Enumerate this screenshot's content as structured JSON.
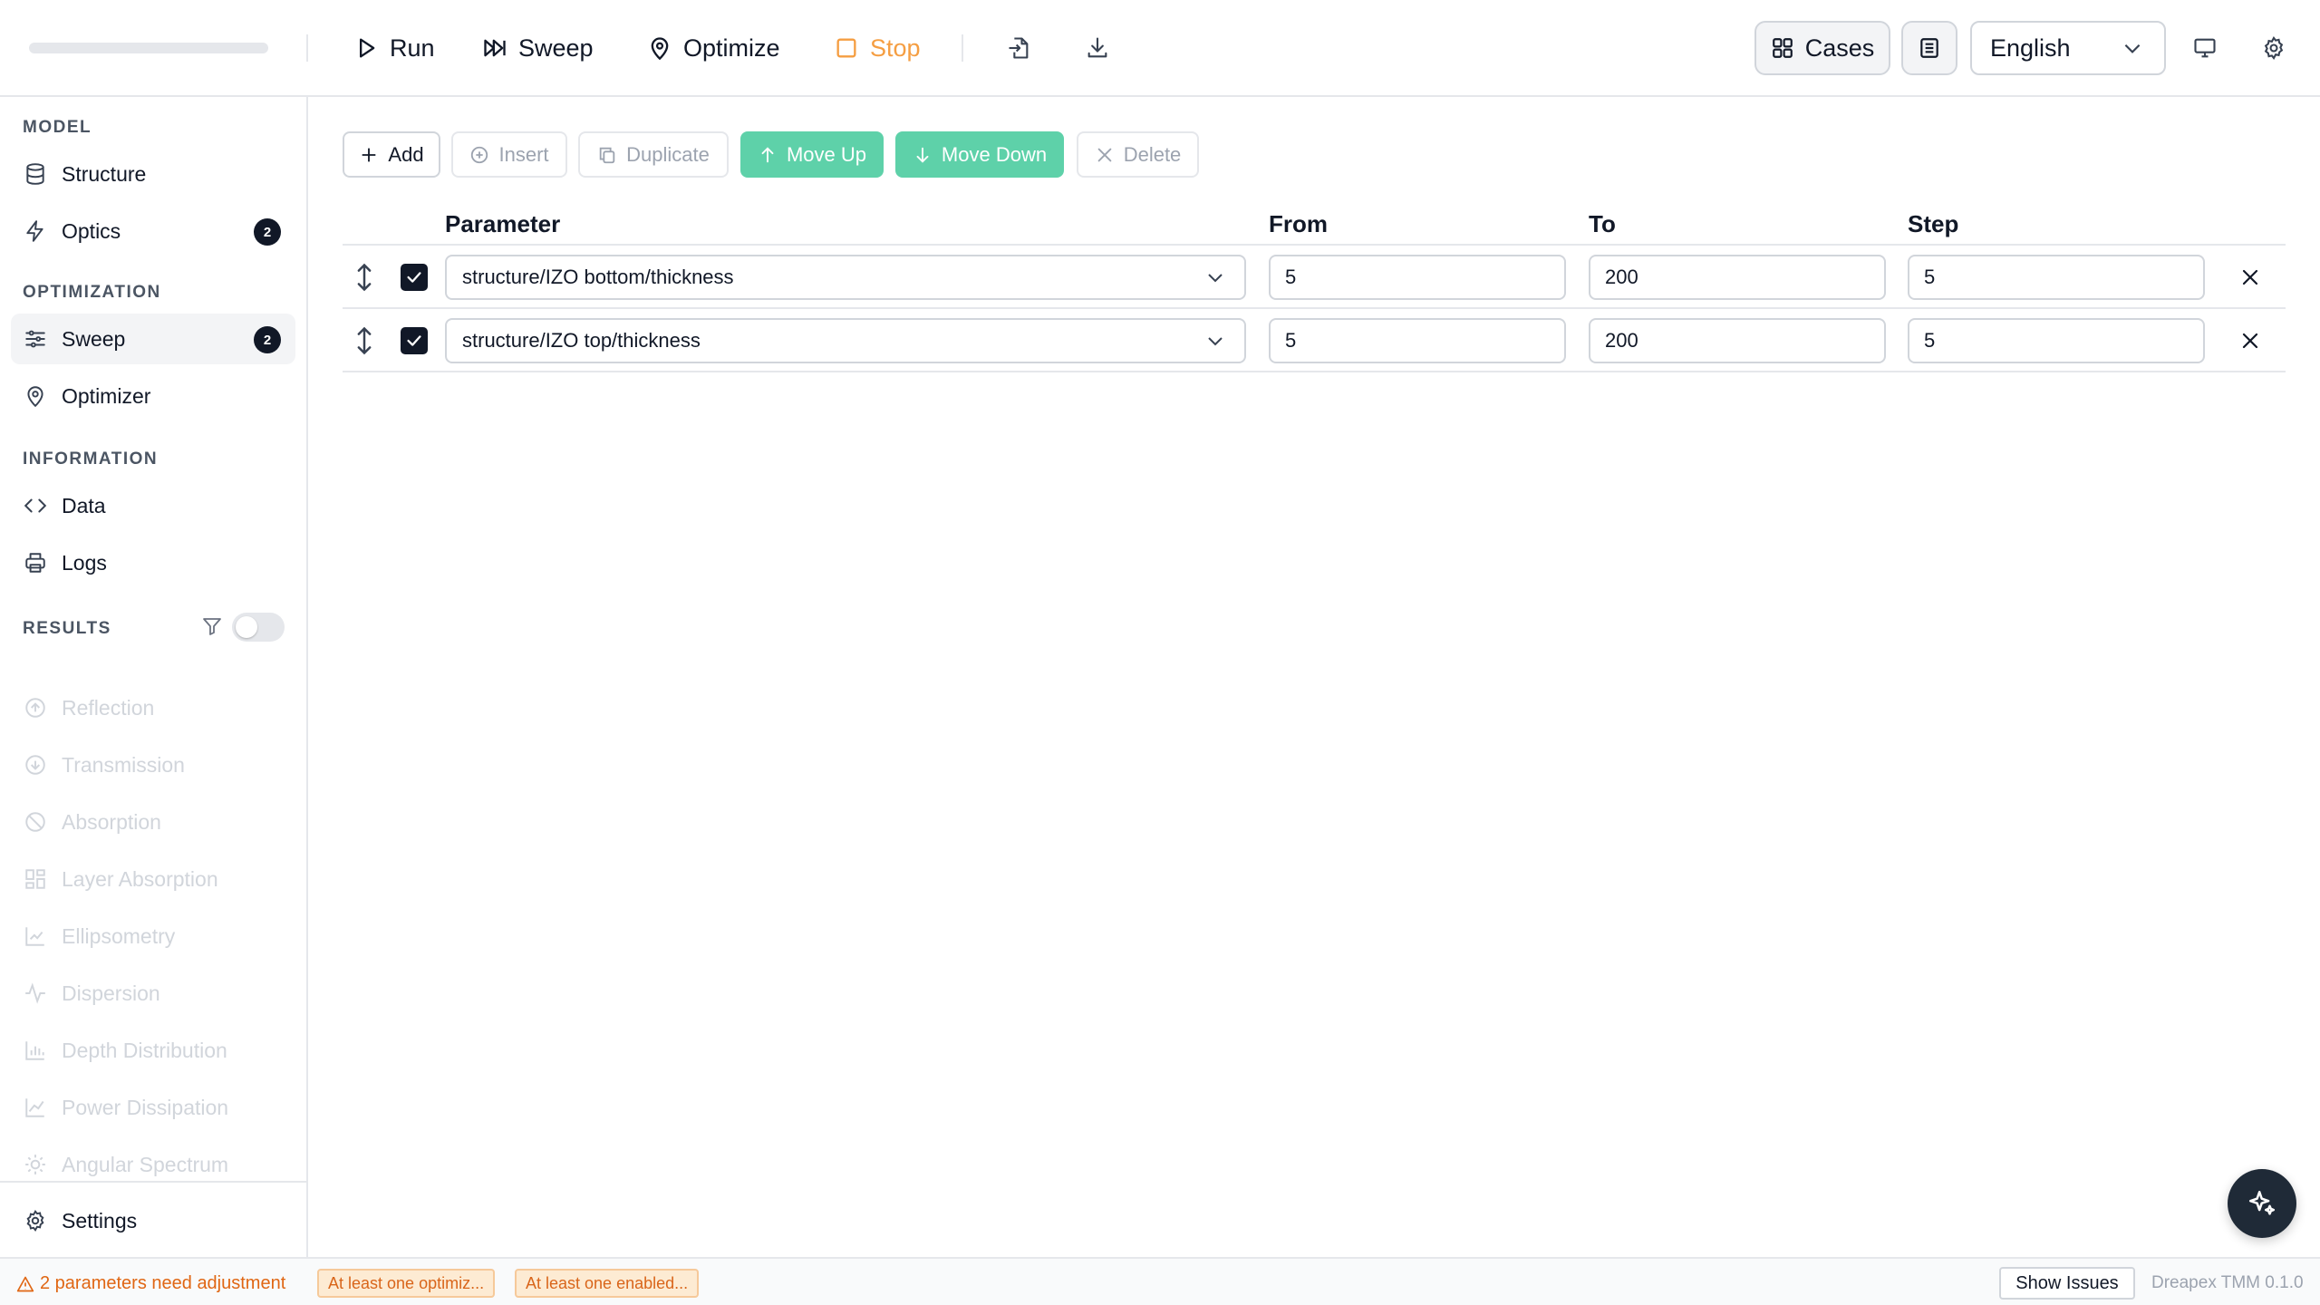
{
  "toolbar": {
    "run_label": "Run",
    "sweep_label": "Sweep",
    "optimize_label": "Optimize",
    "stop_label": "Stop",
    "cases_label": "Cases",
    "language_value": "English"
  },
  "sidebar": {
    "model_heading": "MODEL",
    "structure_label": "Structure",
    "optics_label": "Optics",
    "optics_badge": "2",
    "optimization_heading": "OPTIMIZATION",
    "sweep_label": "Sweep",
    "sweep_badge": "2",
    "optimizer_label": "Optimizer",
    "information_heading": "INFORMATION",
    "data_label": "Data",
    "logs_label": "Logs",
    "results_heading": "RESULTS",
    "results": [
      "Reflection",
      "Transmission",
      "Absorption",
      "Layer Absorption",
      "Ellipsometry",
      "Dispersion",
      "Depth Distribution",
      "Power Dissipation",
      "Angular Spectrum"
    ],
    "settings_label": "Settings"
  },
  "actions": {
    "add": "Add",
    "insert": "Insert",
    "duplicate": "Duplicate",
    "move_up": "Move Up",
    "move_down": "Move Down",
    "delete": "Delete"
  },
  "table": {
    "headers": {
      "parameter": "Parameter",
      "from": "From",
      "to": "To",
      "step": "Step"
    },
    "rows": [
      {
        "enabled": true,
        "parameter": "structure/IZO bottom/thickness",
        "from": "5",
        "to": "200",
        "step": "5"
      },
      {
        "enabled": true,
        "parameter": "structure/IZO top/thickness",
        "from": "5",
        "to": "200",
        "step": "5"
      }
    ]
  },
  "status": {
    "warning": "2 parameters need adjustment",
    "chip_1": "At least one optimiz...",
    "chip_2": "At least one enabled...",
    "show_issues": "Show Issues",
    "version": "Dreapex TMM 0.1.0"
  },
  "colors": {
    "accent_green": "#5ed1a9",
    "stop_orange": "#f59e42",
    "warning_orange": "#e06613",
    "dark": "#111827"
  }
}
